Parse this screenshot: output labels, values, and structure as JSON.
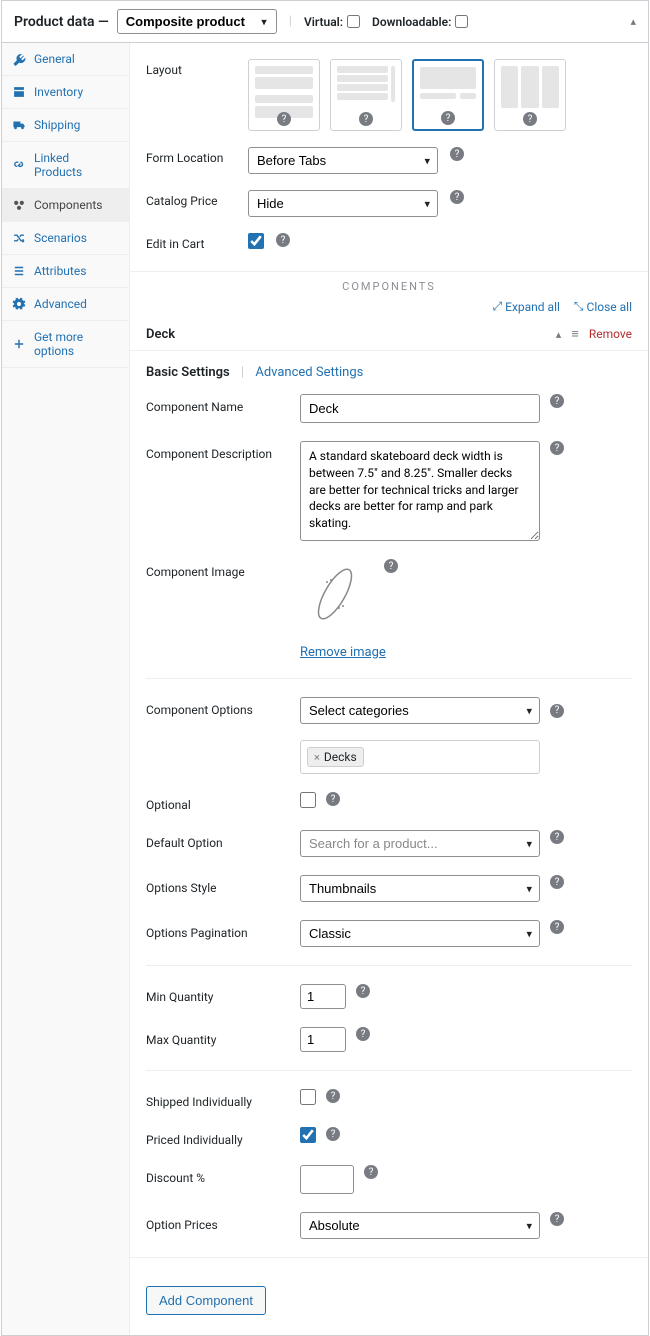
{
  "header": {
    "title": "Product data —",
    "type_select": "Composite product",
    "virtual_label": "Virtual:",
    "downloadable_label": "Downloadable:"
  },
  "sidebar": {
    "items": [
      {
        "label": "General"
      },
      {
        "label": "Inventory"
      },
      {
        "label": "Shipping"
      },
      {
        "label": "Linked Products"
      },
      {
        "label": "Components"
      },
      {
        "label": "Scenarios"
      },
      {
        "label": "Attributes"
      },
      {
        "label": "Advanced"
      },
      {
        "label": "Get more options"
      }
    ]
  },
  "layout": {
    "label": "Layout",
    "form_location_label": "Form Location",
    "form_location_value": "Before Tabs",
    "catalog_price_label": "Catalog Price",
    "catalog_price_value": "Hide",
    "edit_in_cart_label": "Edit in Cart"
  },
  "components_section": {
    "heading": "COMPONENTS",
    "expand_all": "Expand all",
    "close_all": "Close all"
  },
  "component": {
    "title": "Deck",
    "remove": "Remove",
    "tab_basic": "Basic Settings",
    "tab_advanced": "Advanced Settings",
    "name_label": "Component Name",
    "name_value": "Deck",
    "desc_label": "Component Description",
    "desc_value": "A standard skateboard deck width is between 7.5\" and 8.25\". Smaller decks are better for technical tricks and larger decks are better for ramp and park skating.",
    "image_label": "Component Image",
    "remove_image": "Remove image",
    "options_label": "Component Options",
    "options_select": "Select categories",
    "options_tag": "Decks",
    "optional_label": "Optional",
    "default_label": "Default Option",
    "default_placeholder": "Search for a product...",
    "style_label": "Options Style",
    "style_value": "Thumbnails",
    "pagination_label": "Options Pagination",
    "pagination_value": "Classic",
    "min_label": "Min Quantity",
    "min_value": "1",
    "max_label": "Max Quantity",
    "max_value": "1",
    "shipped_label": "Shipped Individually",
    "priced_label": "Priced Individually",
    "discount_label": "Discount %",
    "prices_label": "Option Prices",
    "prices_value": "Absolute"
  },
  "add_component": "Add Component"
}
